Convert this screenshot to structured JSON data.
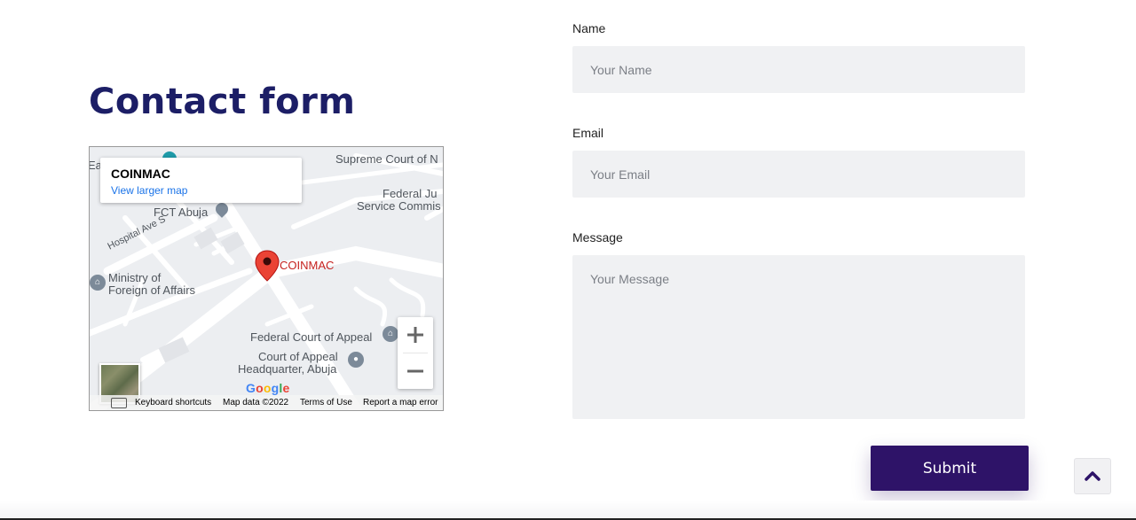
{
  "section": {
    "title": "Contact form"
  },
  "map": {
    "info_title": "COINMAC",
    "info_link": "View larger map",
    "pin_label": "COINMAC",
    "labels": {
      "supreme_court": "Supreme Court of N",
      "federal_judicial_1": "Federal Ju",
      "federal_judicial_2": "Service Commis",
      "fct_abuja": "FCT Abuja",
      "hospital_ave": "Hospital Ave S",
      "ministry_1": "Ministry of",
      "ministry_2": "Foreign of Affairs",
      "federal_court_appeal": "Federal Court of Appeal",
      "court_appeal_hq_1": "Court of Appeal",
      "court_appeal_hq_2": "Headquarter, Abuja",
      "partial_left": "Ea"
    },
    "google_logo": "Google",
    "attribution": {
      "keyboard": "Keyboard shortcuts",
      "map_data": "Map data ©2022",
      "terms": "Terms of Use",
      "report": "Report a map error"
    }
  },
  "form": {
    "name_label": "Name",
    "name_placeholder": "Your Name",
    "email_label": "Email",
    "email_placeholder": "Your Email",
    "message_label": "Message",
    "message_placeholder": "Your Message",
    "submit_label": "Submit"
  },
  "colors": {
    "title": "#1c1e66",
    "submit_bg": "#2e1368",
    "field_bg": "#f0f1f3",
    "map_pin": "#ea4335",
    "link": "#1a73e8"
  },
  "icons": {
    "zoom_in": "plus-icon",
    "zoom_out": "minus-icon",
    "back_to_top": "chevron-up-icon",
    "map_pin": "map-pin-icon"
  }
}
